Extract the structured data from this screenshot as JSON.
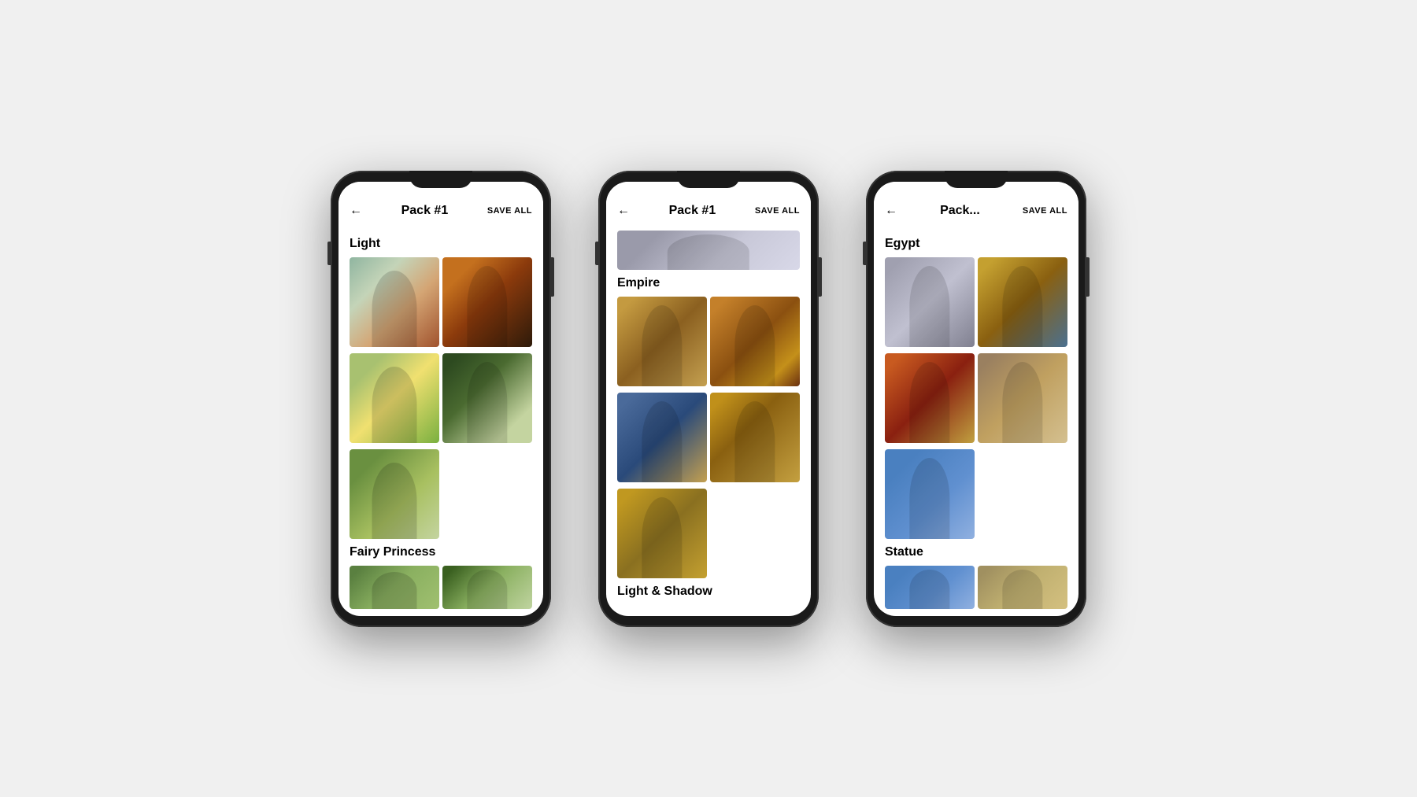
{
  "phones": [
    {
      "id": "phone1",
      "header": {
        "back_label": "←",
        "title": "Pack #1",
        "save_label": "SAVE ALL"
      },
      "sections": [
        {
          "id": "light",
          "title": "Light",
          "images": [
            {
              "id": "p1i1",
              "alt": "Woman in garden with trees",
              "color_class": "p1-img1"
            },
            {
              "id": "p1i2",
              "alt": "Woman portrait warm tones",
              "color_class": "p1-img2"
            },
            {
              "id": "p1i3",
              "alt": "Woman in sunny meadow",
              "color_class": "p1-img3"
            },
            {
              "id": "p1i4",
              "alt": "Woman in dark forest",
              "color_class": "p1-img4"
            },
            {
              "id": "p1i5",
              "alt": "Woman in green setting",
              "color_class": "p1-img5"
            }
          ]
        },
        {
          "id": "fairy-princess",
          "title": "Fairy Princess",
          "images": [
            {
              "id": "p1i6",
              "alt": "Fairy princess forest",
              "color_class": "p1-img6"
            },
            {
              "id": "p1i7",
              "alt": "Fairy princess nature",
              "color_class": "p1-img7"
            }
          ]
        }
      ]
    },
    {
      "id": "phone2",
      "header": {
        "back_label": "←",
        "title": "Pack #1",
        "save_label": "SAVE ALL"
      },
      "sections": [
        {
          "id": "partial-top",
          "images": [
            {
              "id": "p2i0",
              "alt": "Partial image top",
              "color_class": "p2-img0",
              "single": true,
              "partial": true
            }
          ]
        },
        {
          "id": "empire",
          "title": "Empire",
          "images": [
            {
              "id": "p2i1",
              "alt": "Empire portrait 1",
              "color_class": "p2-img1"
            },
            {
              "id": "p2i2",
              "alt": "Empire portrait 2",
              "color_class": "p2-img2"
            },
            {
              "id": "p2i3",
              "alt": "Empire portrait 3",
              "color_class": "p2-img3"
            },
            {
              "id": "p2i4",
              "alt": "Empire portrait 4",
              "color_class": "p2-img4"
            },
            {
              "id": "p2i5",
              "alt": "Empire portrait 5 single",
              "color_class": "p2-img5",
              "single": true
            }
          ]
        },
        {
          "id": "light-shadow",
          "title": "Light & Shadow"
        }
      ]
    },
    {
      "id": "phone3",
      "header": {
        "back_label": "←",
        "title": "Pack...",
        "save_label": "SAVE ALL"
      },
      "sections": [
        {
          "id": "egypt",
          "title": "Egypt",
          "images": [
            {
              "id": "p3i1",
              "alt": "Egypt portrait silver",
              "color_class": "p3-img1"
            },
            {
              "id": "p3i2",
              "alt": "Egypt portrait gold blue",
              "color_class": "p3-img2"
            },
            {
              "id": "p3i3",
              "alt": "Egypt portrait red",
              "color_class": "p3-img3"
            },
            {
              "id": "p3i4",
              "alt": "Egypt portrait headdress",
              "color_class": "p3-img4"
            },
            {
              "id": "p3i5",
              "alt": "Egypt portrait blue",
              "color_class": "p3-img5"
            }
          ]
        },
        {
          "id": "statue",
          "title": "Statue",
          "images": [
            {
              "id": "p3i6",
              "alt": "Statue blue grey",
              "color_class": "p3-img5"
            },
            {
              "id": "p3i7",
              "alt": "Statue gold",
              "color_class": "p3-img6"
            }
          ]
        }
      ]
    }
  ]
}
